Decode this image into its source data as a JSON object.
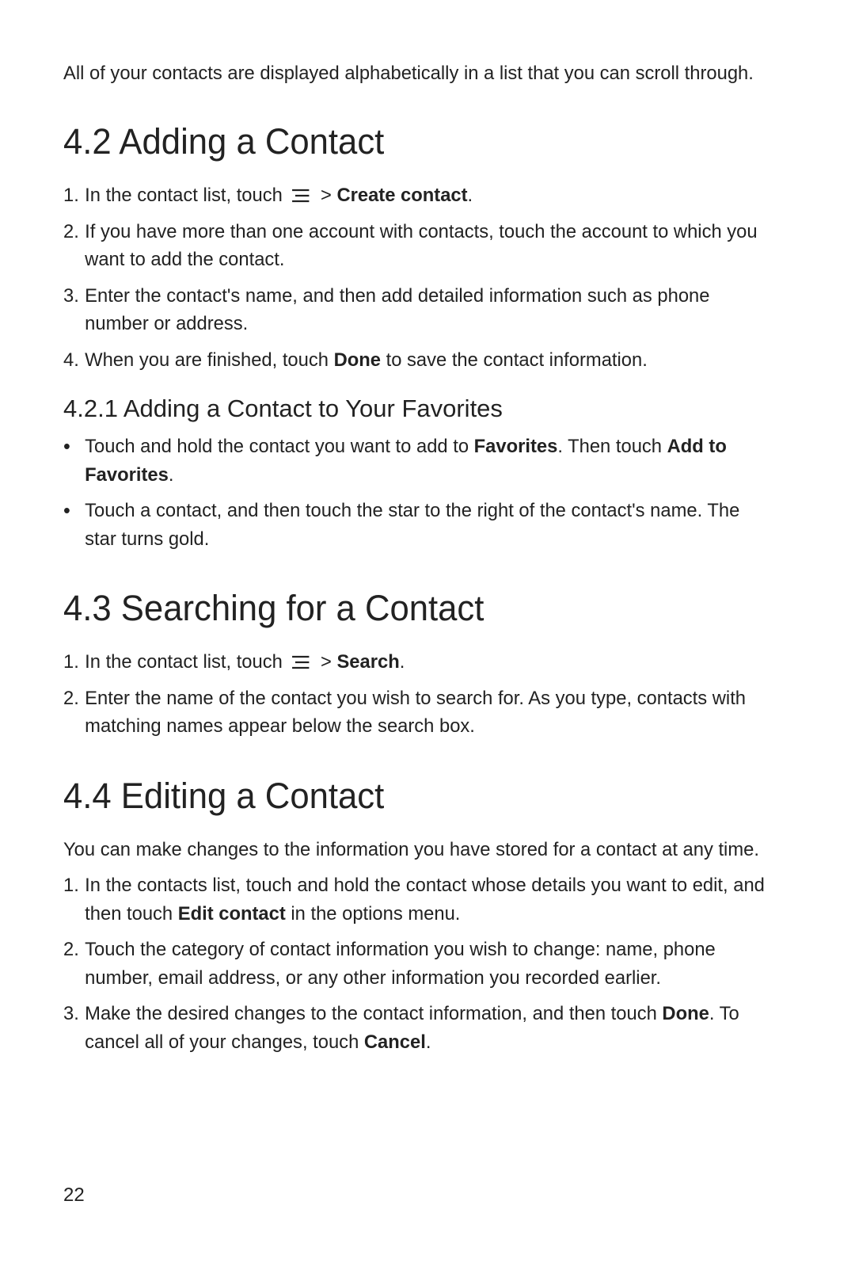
{
  "intro": "All of your contacts are displayed alphabetically in a list that you can scroll through.",
  "s42": {
    "title": "4.2  Adding a Contact",
    "step1_pre": "In the contact list, touch ",
    "step1_gt": " > ",
    "step1_bold": "Create contact",
    "step1_post": ".",
    "step2": "If you have more than one account with contacts, touch the account to which you want to add the contact.",
    "step3": "Enter the contact's name, and then add detailed information such as phone number or address.",
    "step4_pre": "When you are finished, touch ",
    "step4_bold": "Done",
    "step4_post": " to save the contact information."
  },
  "s421": {
    "title": "4.2.1  Adding a Contact to Your Favorites",
    "b1_pre": "Touch and hold the contact you want to add to ",
    "b1_fav": "Favorites",
    "b1_mid": ". Then touch ",
    "b1_add": "Add to Favorites",
    "b1_post": ".",
    "b2": "Touch a contact, and then touch the star to the right of the contact's name. The star turns gold."
  },
  "s43": {
    "title": "4.3  Searching for a Contact",
    "step1_pre": "In the contact list, touch ",
    "step1_gt": " > ",
    "step1_bold": "Search",
    "step1_post": ".",
    "step2": "Enter the name of the contact you wish to search for. As you type, contacts with matching names appear below the search box."
  },
  "s44": {
    "title": "4.4  Editing a Contact",
    "intro": "You can make changes to the information you have stored for a contact at any time.",
    "step1_pre": "In the contacts list, touch and hold the contact whose details you want to edit, and then touch ",
    "step1_bold": "Edit contact",
    "step1_post": " in the options menu.",
    "step2": "Touch the category of contact information you wish to change: name, phone number, email address, or any other information you recorded earlier.",
    "step3_pre": "Make the desired changes to the contact information, and then touch ",
    "step3_done": "Done",
    "step3_mid": ". To cancel all of your changes, touch ",
    "step3_cancel": "Cancel",
    "step3_post": "."
  },
  "markers": {
    "n1": "1.",
    "n2": "2.",
    "n3": "3.",
    "n4": "4.",
    "bullet": "•"
  },
  "pageNumber": "22"
}
